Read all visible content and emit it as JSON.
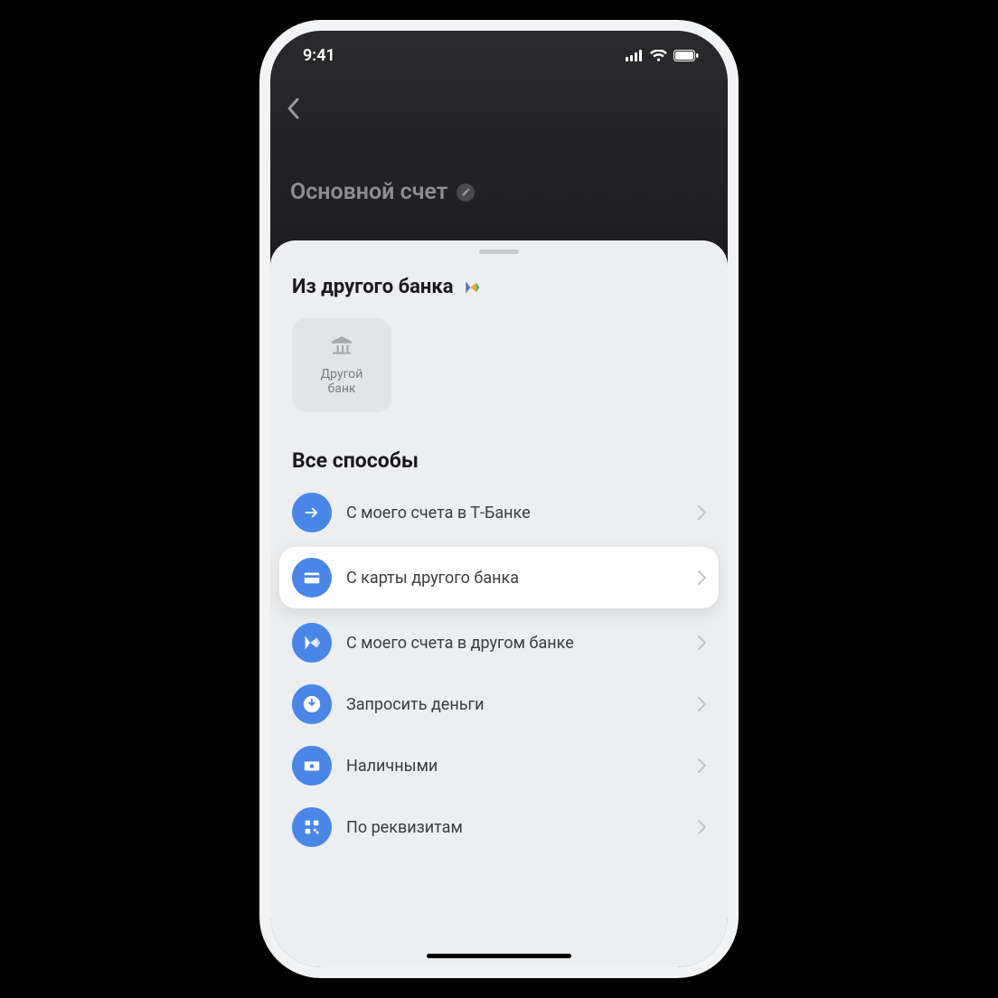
{
  "status": {
    "time": "9:41"
  },
  "header": {
    "account_title": "Основной счет"
  },
  "sheet": {
    "from_other_title": "Из другого банка",
    "other_bank_tile": "Другой\nбанк",
    "all_methods_title": "Все способы",
    "methods": [
      {
        "label": "С моего счета в Т‑Банке",
        "icon": "arrow-right-icon",
        "highlight": false
      },
      {
        "label": "С карты другого банка",
        "icon": "card-icon",
        "highlight": true
      },
      {
        "label": "С моего счета в другом банке",
        "icon": "sbp-icon",
        "highlight": false
      },
      {
        "label": "Запросить деньги",
        "icon": "download-icon",
        "highlight": false
      },
      {
        "label": "Наличными",
        "icon": "cash-icon",
        "highlight": false
      },
      {
        "label": "По реквизитам",
        "icon": "qr-icon",
        "highlight": false
      }
    ]
  }
}
